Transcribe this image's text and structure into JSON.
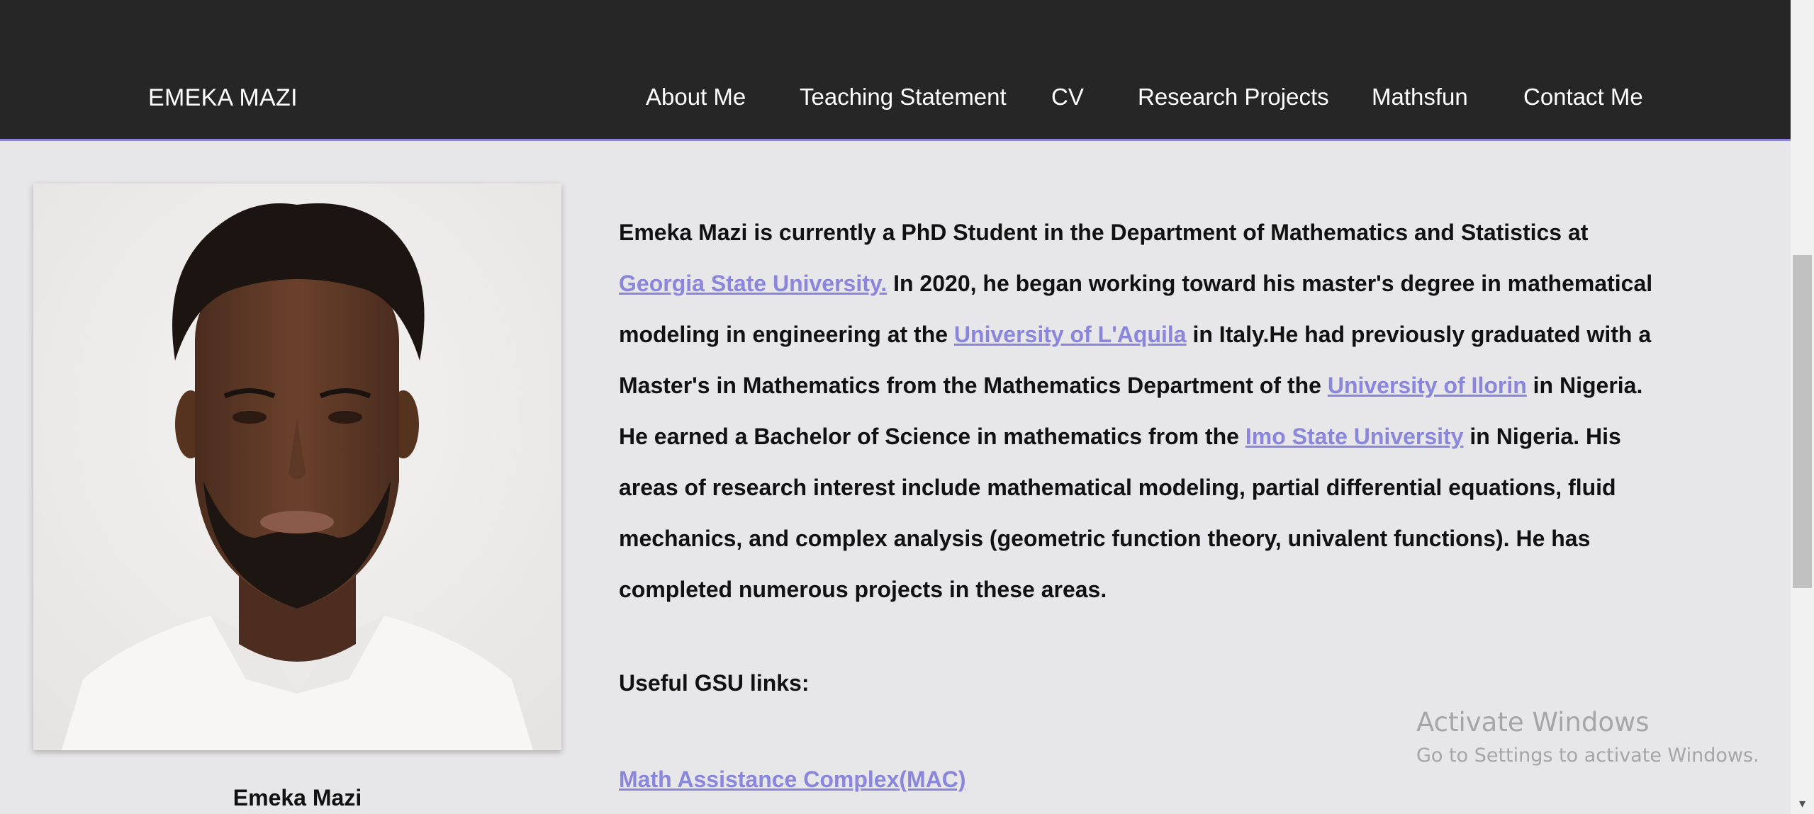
{
  "header": {
    "site_title": "EMEKA MAZI",
    "nav": [
      {
        "label": "About Me"
      },
      {
        "label": "Teaching Statement"
      },
      {
        "label": "CV"
      },
      {
        "label": "Research Projects"
      },
      {
        "label": "Mathsfun"
      },
      {
        "label": "Contact Me"
      }
    ]
  },
  "profile": {
    "caption": "Emeka Mazi"
  },
  "bio": {
    "p1": "Emeka Mazi is currently a PhD Student in the Department of Mathematics and Statistics at ",
    "link1": "Georgia State University.",
    "p2": "  In 2020, he began working toward his master's degree in mathematical modeling in engineering at the ",
    "link2": "University of L'Aquila",
    "p3": "  in Italy.He had previously graduated with a Master's in Mathematics from the Mathematics Department of the ",
    "link3": "University of Ilorin",
    "p4": "  in Nigeria. He earned a Bachelor of Science in mathematics from the ",
    "link4": "Imo State University",
    "p5": "  in Nigeria. His areas of research interest include mathematical modeling, partial differential equations, fluid mechanics, and complex analysis (geometric function theory, univalent functions). He has completed numerous projects in these areas."
  },
  "links": {
    "heading": "Useful GSU links:",
    "mac": "Math Assistance Complex(MAC)"
  },
  "watermark": {
    "title": "Activate Windows",
    "subtitle": "Go to Settings to activate Windows."
  },
  "colors": {
    "header_bg": "#262626",
    "header_border": "#8b83d8",
    "page_bg": "#e7e6e8",
    "link": "#8a86dc"
  }
}
